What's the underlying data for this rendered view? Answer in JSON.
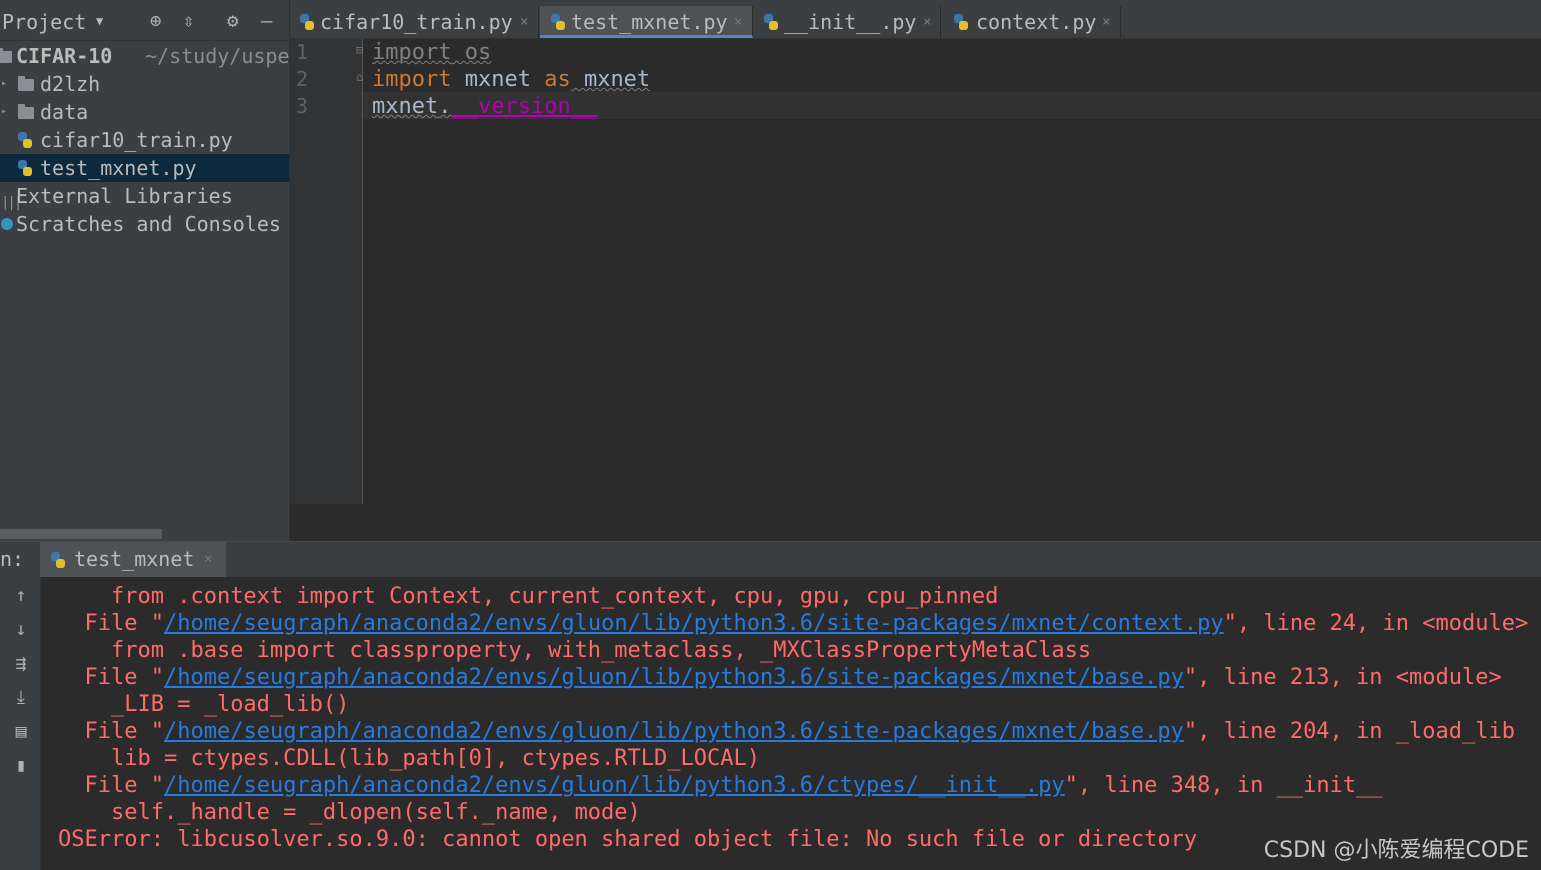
{
  "project_panel": {
    "title": "Project",
    "dropdown_icon": "chevron-down-icon",
    "toolbar_icons": [
      "locate-icon",
      "collapse-all-icon",
      "gear-icon",
      "minimize-icon"
    ],
    "root": {
      "name": "CIFAR-10",
      "path": "~/study/uspe"
    },
    "items": [
      {
        "label": "d2lzh",
        "type": "folder"
      },
      {
        "label": "data",
        "type": "folder"
      },
      {
        "label": "cifar10_train.py",
        "type": "python-file"
      },
      {
        "label": "test_mxnet.py",
        "type": "python-file",
        "selected": true
      }
    ],
    "external_libraries": "External Libraries",
    "scratches": "Scratches and Consoles"
  },
  "editor": {
    "tabs": [
      {
        "label": "cifar10_train.py",
        "active": false
      },
      {
        "label": "test_mxnet.py",
        "active": true
      },
      {
        "label": "__init__.py",
        "active": false
      },
      {
        "label": "context.py",
        "active": false
      }
    ],
    "line_numbers": [
      "1",
      "2",
      "3"
    ],
    "code": {
      "line1": {
        "keyword": "import",
        "rest": " os"
      },
      "line2": {
        "keyword": "import",
        "module": " mxnet ",
        "as": "as",
        "alias": " mxnet"
      },
      "line3": {
        "obj": "mxnet",
        "dot": ".",
        "attr": "__version__"
      }
    }
  },
  "run_panel": {
    "label": "n:",
    "tab_label": "test_mxnet",
    "toolbar_icons": [
      "arrow-up-icon",
      "arrow-down-icon",
      "soft-wrap-icon",
      "scroll-to-end-icon",
      "print-icon",
      "trash-icon"
    ],
    "lines": [
      {
        "indent": "    ",
        "text": "from .context import Context, current_context, cpu, gpu, cpu_pinned"
      },
      {
        "indent": "  ",
        "pre": "File \"",
        "link": "/home/seugraph/anaconda2/envs/gluon/lib/python3.6/site-packages/mxnet/context.py",
        "post": "\", line 24, in <module>"
      },
      {
        "indent": "    ",
        "text": "from .base import classproperty, with_metaclass, _MXClassPropertyMetaClass"
      },
      {
        "indent": "  ",
        "pre": "File \"",
        "link": "/home/seugraph/anaconda2/envs/gluon/lib/python3.6/site-packages/mxnet/base.py",
        "post": "\", line 213, in <module>"
      },
      {
        "indent": "    ",
        "text": "_LIB = _load_lib()"
      },
      {
        "indent": "  ",
        "pre": "File \"",
        "link": "/home/seugraph/anaconda2/envs/gluon/lib/python3.6/site-packages/mxnet/base.py",
        "post": "\", line 204, in _load_lib"
      },
      {
        "indent": "    ",
        "text": "lib = ctypes.CDLL(lib_path[0], ctypes.RTLD_LOCAL)"
      },
      {
        "indent": "  ",
        "pre": "File \"",
        "link": "/home/seugraph/anaconda2/envs/gluon/lib/python3.6/ctypes/__init__.py",
        "post": "\", line 348, in __init__"
      },
      {
        "indent": "    ",
        "text": "self._handle = _dlopen(self._name, mode)"
      },
      {
        "indent": "",
        "text": "OSError: libcusolver.so.9.0: cannot open shared object file: No such file or directory"
      }
    ]
  },
  "watermark": "CSDN @小陈爱编程CODE",
  "colors": {
    "panel_bg": "#3c3f41",
    "editor_bg": "#2b2b2b",
    "keyword": "#cc7832",
    "magic_attr": "#b200b2",
    "error_text": "#ff6b68",
    "link": "#287bde",
    "selection": "#0d293e"
  }
}
